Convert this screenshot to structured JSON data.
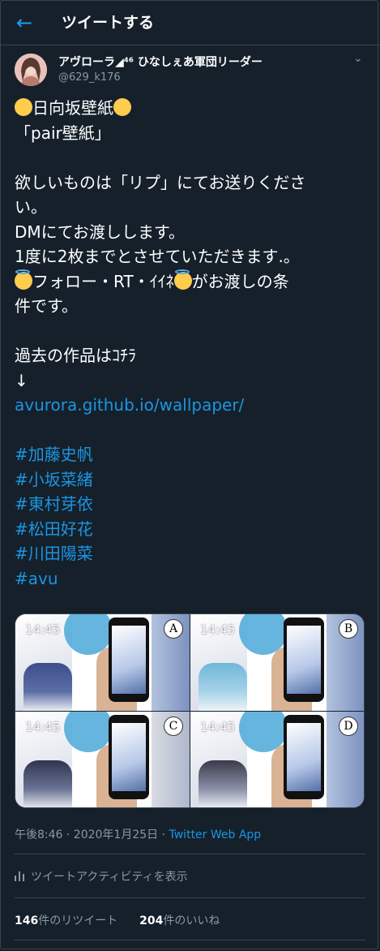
{
  "header": {
    "back_icon": "arrow-left-icon",
    "title": "ツイートする"
  },
  "author": {
    "name": "アヴローラ◢⁴⁶ ひなしぇあ軍団リーダー",
    "handle": "@629_k176"
  },
  "tweet": {
    "title_line": "日向坂壁紙",
    "line2": "「pair壁紙」",
    "p1a": "欲しいものは「リプ」にてお送りくださ",
    "p1b": "い。",
    "p2": "DMにてお渡しします。",
    "p3": "1度に2枚までとさせていただきます.。",
    "p4a_main": "フォロー・RT・ｲｲﾈ",
    "p4a_tail": "がお渡しの条",
    "p4b": "件です。",
    "p5": "過去の作品はｺﾁﾗ",
    "arrow": "↓",
    "url": "avurora.github.io/wallpaper/",
    "hashtags": [
      "#加藤史帆",
      "#小坂菜緒",
      "#東村芽依",
      "#松田好花",
      "#川田陽菜",
      "#avu"
    ]
  },
  "media": {
    "time_text": "14:45",
    "labels": [
      "A",
      "B",
      "C",
      "D"
    ]
  },
  "meta": {
    "time": "午後8:46 · 2020年1月25日 · ",
    "source": "Twitter Web App"
  },
  "activity": {
    "label": "ツイートアクティビティを表示"
  },
  "stats": {
    "retweets_count": "146",
    "retweets_label": "件のリツイート",
    "likes_count": "204",
    "likes_label": "件のいいね"
  },
  "colors": {
    "background": "#15202b",
    "link": "#1b95e0",
    "accent": "#1da1f2",
    "secondary_text": "#8899a6"
  }
}
